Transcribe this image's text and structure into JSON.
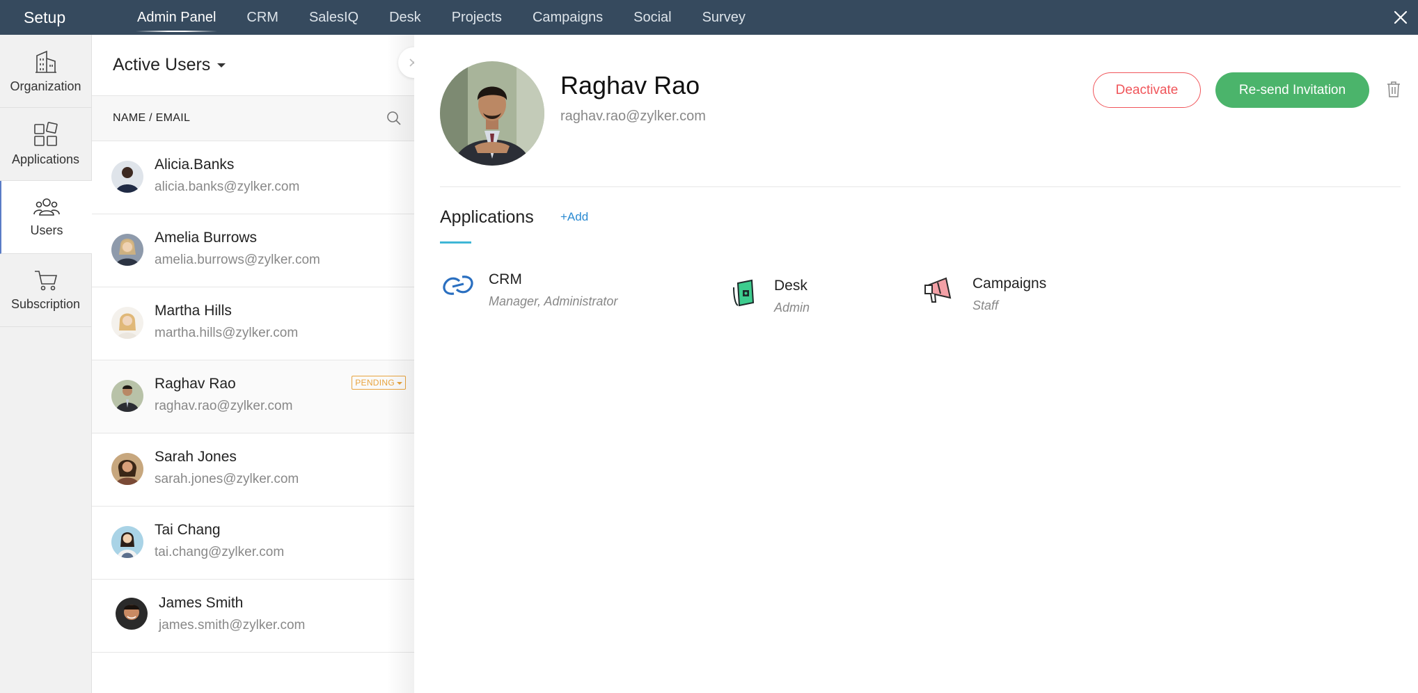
{
  "topbar": {
    "brand": "Setup",
    "tabs": [
      "Admin Panel",
      "CRM",
      "SalesIQ",
      "Desk",
      "Projects",
      "Campaigns",
      "Social",
      "Survey"
    ],
    "active_tab": "Admin Panel"
  },
  "sidebar": {
    "items": [
      {
        "label": "Organization",
        "icon": "building-icon"
      },
      {
        "label": "Applications",
        "icon": "apps-grid-icon"
      },
      {
        "label": "Users",
        "icon": "users-icon",
        "active": true
      },
      {
        "label": "Subscription",
        "icon": "cart-icon"
      }
    ]
  },
  "userlist": {
    "title": "Active Users",
    "column_header": "NAME / EMAIL",
    "users": [
      {
        "name": "Alicia.Banks",
        "email": "alicia.banks@zylker.com"
      },
      {
        "name": "Amelia Burrows",
        "email": "amelia.burrows@zylker.com"
      },
      {
        "name": "Martha Hills",
        "email": "martha.hills@zylker.com"
      },
      {
        "name": "Raghav Rao",
        "email": "raghav.rao@zylker.com",
        "badge": "PENDING"
      },
      {
        "name": "Sarah Jones",
        "email": "sarah.jones@zylker.com"
      },
      {
        "name": "Tai Chang",
        "email": "tai.chang@zylker.com"
      },
      {
        "name": "James Smith",
        "email": "james.smith@zylker.com"
      }
    ]
  },
  "detail": {
    "name": "Raghav Rao",
    "email": "raghav.rao@zylker.com",
    "deactivate_label": "Deactivate",
    "resend_label": "Re-send Invitation",
    "apps_title": "Applications",
    "add_label": "+Add",
    "apps": [
      {
        "name": "CRM",
        "role": "Manager, Administrator",
        "icon": "crm-icon"
      },
      {
        "name": "Desk",
        "role": "Admin",
        "icon": "desk-icon"
      },
      {
        "name": "Campaigns",
        "role": "Staff",
        "icon": "campaigns-icon"
      }
    ]
  },
  "colors": {
    "topbar": "#364a5e",
    "deactivate": "#f0555a",
    "resend": "#4bb46b",
    "link": "#2a8ad1",
    "pending": "#e8a33d"
  }
}
